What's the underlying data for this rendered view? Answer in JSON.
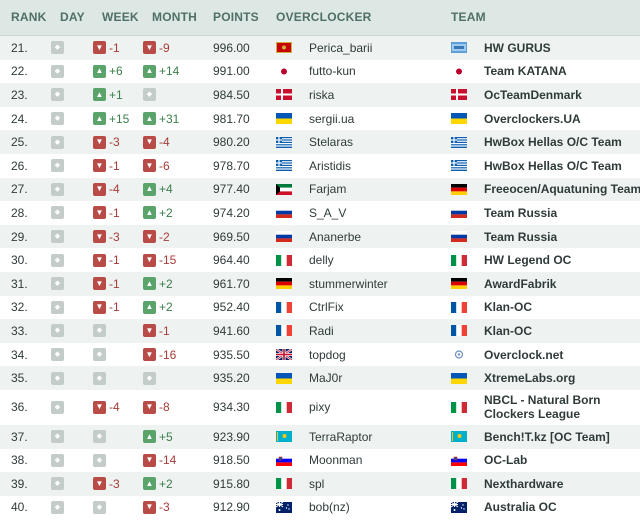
{
  "header": {
    "rank": "RANK",
    "day": "DAY",
    "week": "WEEK",
    "month": "MONTH",
    "points": "POINTS",
    "overclocker": "OVERCLOCKER",
    "team": "TEAM"
  },
  "rows": [
    {
      "rank": "21.",
      "day": {
        "dir": "same",
        "text": ""
      },
      "week": {
        "dir": "down",
        "text": "-1"
      },
      "month": {
        "dir": "down",
        "text": "-9"
      },
      "points": "996.00",
      "ov_flag": "montenegro-flag",
      "overclocker": "Perica_barii",
      "team_flag": "hwgurus-logo",
      "team": "HW GURUS"
    },
    {
      "rank": "22.",
      "day": {
        "dir": "same",
        "text": ""
      },
      "week": {
        "dir": "up",
        "text": "+6"
      },
      "month": {
        "dir": "up",
        "text": "+14"
      },
      "points": "991.00",
      "ov_flag": "japan-flag",
      "overclocker": "futto-kun",
      "team_flag": "japan-flag",
      "team": "Team KATANA"
    },
    {
      "rank": "23.",
      "day": {
        "dir": "same",
        "text": ""
      },
      "week": {
        "dir": "up",
        "text": "+1"
      },
      "month": {
        "dir": "same",
        "text": ""
      },
      "points": "984.50",
      "ov_flag": "denmark-flag",
      "overclocker": "riska",
      "team_flag": "denmark-flag",
      "team": "OcTeamDenmark"
    },
    {
      "rank": "24.",
      "day": {
        "dir": "same",
        "text": ""
      },
      "week": {
        "dir": "up",
        "text": "+15"
      },
      "month": {
        "dir": "up",
        "text": "+31"
      },
      "points": "981.70",
      "ov_flag": "ukraine-flag",
      "overclocker": "sergii.ua",
      "team_flag": "ukraine-flag",
      "team": "Overclockers.UA"
    },
    {
      "rank": "25.",
      "day": {
        "dir": "same",
        "text": ""
      },
      "week": {
        "dir": "down",
        "text": "-3"
      },
      "month": {
        "dir": "down",
        "text": "-4"
      },
      "points": "980.20",
      "ov_flag": "greece-flag",
      "overclocker": "Stelaras",
      "team_flag": "greece-flag",
      "team": "HwBox Hellas O/C Team"
    },
    {
      "rank": "26.",
      "day": {
        "dir": "same",
        "text": ""
      },
      "week": {
        "dir": "down",
        "text": "-1"
      },
      "month": {
        "dir": "down",
        "text": "-6"
      },
      "points": "978.70",
      "ov_flag": "greece-flag",
      "overclocker": "Aristidis",
      "team_flag": "greece-flag",
      "team": "HwBox Hellas O/C Team"
    },
    {
      "rank": "27.",
      "day": {
        "dir": "same",
        "text": ""
      },
      "week": {
        "dir": "down",
        "text": "-4"
      },
      "month": {
        "dir": "up",
        "text": "+4"
      },
      "points": "977.40",
      "ov_flag": "kuwait-flag",
      "overclocker": "Farjam",
      "team_flag": "germany-flag",
      "team": "Freeocen/Aquatuning Team"
    },
    {
      "rank": "28.",
      "day": {
        "dir": "same",
        "text": ""
      },
      "week": {
        "dir": "down",
        "text": "-1"
      },
      "month": {
        "dir": "up",
        "text": "+2"
      },
      "points": "974.20",
      "ov_flag": "russia-flag",
      "overclocker": "S_A_V",
      "team_flag": "russia-flag",
      "team": "Team Russia"
    },
    {
      "rank": "29.",
      "day": {
        "dir": "same",
        "text": ""
      },
      "week": {
        "dir": "down",
        "text": "-3"
      },
      "month": {
        "dir": "down",
        "text": "-2"
      },
      "points": "969.50",
      "ov_flag": "russia-flag",
      "overclocker": "Ananerbe",
      "team_flag": "russia-flag",
      "team": "Team Russia"
    },
    {
      "rank": "30.",
      "day": {
        "dir": "same",
        "text": ""
      },
      "week": {
        "dir": "down",
        "text": "-1"
      },
      "month": {
        "dir": "down",
        "text": "-15"
      },
      "points": "964.40",
      "ov_flag": "italy-flag",
      "overclocker": "delly",
      "team_flag": "italy-flag",
      "team": "HW Legend OC"
    },
    {
      "rank": "31.",
      "day": {
        "dir": "same",
        "text": ""
      },
      "week": {
        "dir": "down",
        "text": "-1"
      },
      "month": {
        "dir": "up",
        "text": "+2"
      },
      "points": "961.70",
      "ov_flag": "germany-flag",
      "overclocker": "stummerwinter",
      "team_flag": "germany-flag",
      "team": "AwardFabrik"
    },
    {
      "rank": "32.",
      "day": {
        "dir": "same",
        "text": ""
      },
      "week": {
        "dir": "down",
        "text": "-1"
      },
      "month": {
        "dir": "up",
        "text": "+2"
      },
      "points": "952.40",
      "ov_flag": "france-flag",
      "overclocker": "CtrlFix",
      "team_flag": "france-flag",
      "team": "Klan-OC"
    },
    {
      "rank": "33.",
      "day": {
        "dir": "same",
        "text": ""
      },
      "week": {
        "dir": "same",
        "text": ""
      },
      "month": {
        "dir": "down",
        "text": "-1"
      },
      "points": "941.60",
      "ov_flag": "france-flag",
      "overclocker": "Radi",
      "team_flag": "france-flag",
      "team": "Klan-OC"
    },
    {
      "rank": "34.",
      "day": {
        "dir": "same",
        "text": ""
      },
      "week": {
        "dir": "same",
        "text": ""
      },
      "month": {
        "dir": "down",
        "text": "-16"
      },
      "points": "935.50",
      "ov_flag": "uk-flag",
      "overclocker": "topdog",
      "team_flag": "overclocknet-logo",
      "team": "Overclock.net"
    },
    {
      "rank": "35.",
      "day": {
        "dir": "same",
        "text": ""
      },
      "week": {
        "dir": "same",
        "text": ""
      },
      "month": {
        "dir": "same",
        "text": ""
      },
      "points": "935.20",
      "ov_flag": "ukraine-flag",
      "overclocker": "MaJ0r",
      "team_flag": "ukraine-flag",
      "team": "XtremeLabs.org"
    },
    {
      "rank": "36.",
      "day": {
        "dir": "same",
        "text": ""
      },
      "week": {
        "dir": "down",
        "text": "-4"
      },
      "month": {
        "dir": "down",
        "text": "-8"
      },
      "points": "934.30",
      "ov_flag": "italy-flag",
      "overclocker": "pixy",
      "team_flag": "italy-flag",
      "team": "NBCL - Natural Born Clockers League",
      "tall": true
    },
    {
      "rank": "37.",
      "day": {
        "dir": "same",
        "text": ""
      },
      "week": {
        "dir": "same",
        "text": ""
      },
      "month": {
        "dir": "up",
        "text": "+5"
      },
      "points": "923.90",
      "ov_flag": "kazakhstan-flag",
      "overclocker": "TerraRaptor",
      "team_flag": "kazakhstan-flag",
      "team": "Bench!T.kz [OC Team]"
    },
    {
      "rank": "38.",
      "day": {
        "dir": "same",
        "text": ""
      },
      "week": {
        "dir": "same",
        "text": ""
      },
      "month": {
        "dir": "down",
        "text": "-14"
      },
      "points": "918.50",
      "ov_flag": "slovenia-flag",
      "overclocker": "Moonman",
      "team_flag": "slovenia-flag",
      "team": "OC-Lab"
    },
    {
      "rank": "39.",
      "day": {
        "dir": "same",
        "text": ""
      },
      "week": {
        "dir": "down",
        "text": "-3"
      },
      "month": {
        "dir": "up",
        "text": "+2"
      },
      "points": "915.80",
      "ov_flag": "italy-flag",
      "overclocker": "spl",
      "team_flag": "italy-flag",
      "team": "Nexthardware"
    },
    {
      "rank": "40.",
      "day": {
        "dir": "same",
        "text": ""
      },
      "week": {
        "dir": "same",
        "text": ""
      },
      "month": {
        "dir": "down",
        "text": "-3"
      },
      "points": "912.90",
      "ov_flag": "australia-flag",
      "overclocker": "bob(nz)",
      "team_flag": "australia-flag",
      "team": "Australia OC"
    }
  ],
  "colors": {
    "header_bg": "#dde8e4",
    "header_text": "#4f6f68",
    "row_alt_bg": "#eef3f1",
    "up": "#5aa46b",
    "down": "#b94b47",
    "same": "#c3ccc9"
  }
}
